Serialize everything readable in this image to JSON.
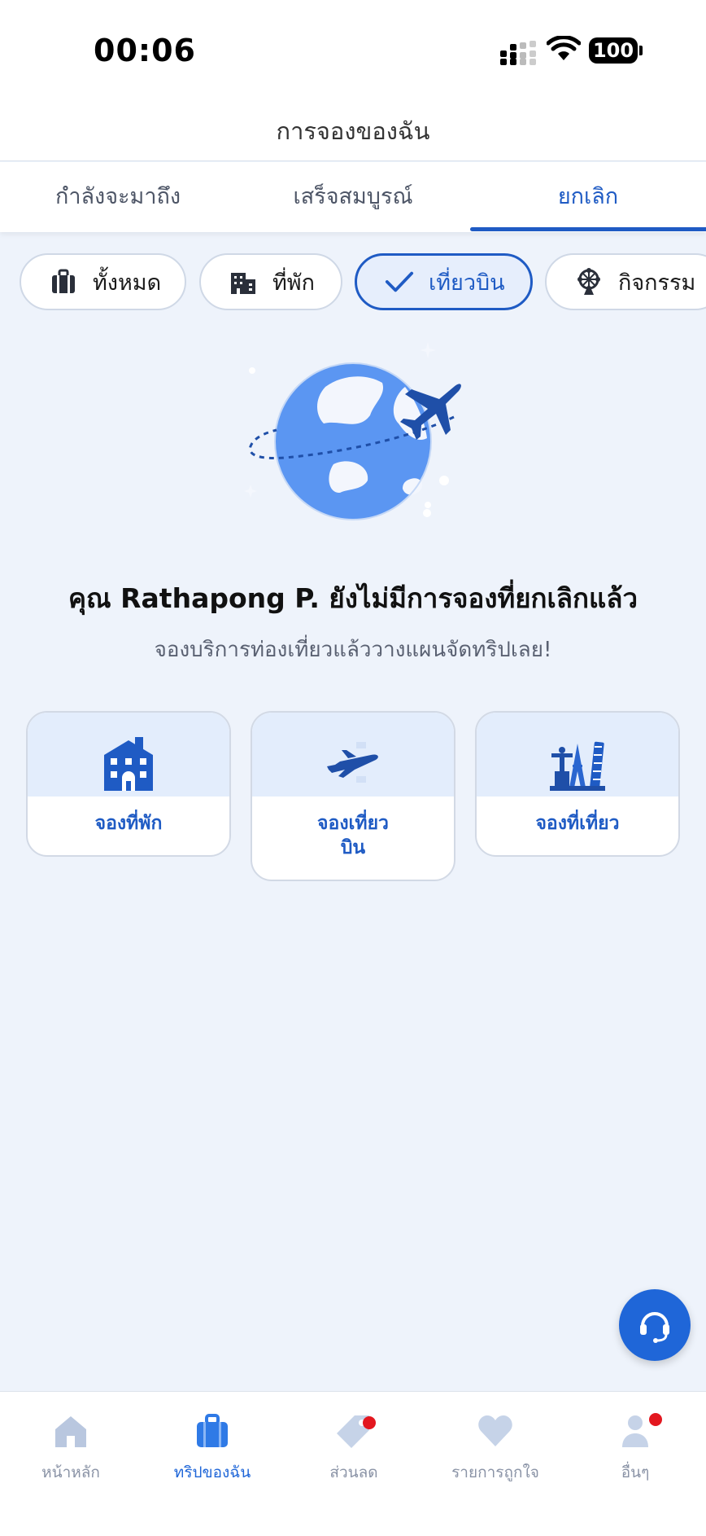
{
  "status": {
    "time": "00:06",
    "battery": "100"
  },
  "header": {
    "title": "การจองของฉัน"
  },
  "tabs": [
    {
      "label": "กำลังจะมาถึง"
    },
    {
      "label": "เสร็จสมบูรณ์"
    },
    {
      "label": "ยกเลิก",
      "active": true
    }
  ],
  "filters": [
    {
      "label": "ทั้งหมด",
      "icon": "suitcase-icon"
    },
    {
      "label": "ที่พัก",
      "icon": "building-icon"
    },
    {
      "label": "เที่ยวบิน",
      "icon": "check-icon",
      "active": true
    },
    {
      "label": "กิจกรรม",
      "icon": "ferris-wheel-icon"
    }
  ],
  "empty": {
    "title": "คุณ Rathapong P. ยังไม่มีการจองที่ยกเลิกแล้ว",
    "subtitle": "จองบริการท่องเที่ยวแล้ววางแผนจัดทริปเลย!"
  },
  "cards": [
    {
      "label": "จองที่พัก",
      "icon": "hotel-icon"
    },
    {
      "label_line1": "จองเที่ยว",
      "label_line2": "บิน",
      "icon": "airplane-icon"
    },
    {
      "label": "จองที่เที่ยว",
      "icon": "landmarks-icon"
    }
  ],
  "bottom_nav": [
    {
      "label": "หน้าหลัก",
      "icon": "home-icon"
    },
    {
      "label": "ทริปของฉัน",
      "icon": "suitcase-icon",
      "active": true
    },
    {
      "label": "ส่วนลด",
      "icon": "tag-icon",
      "badge": true
    },
    {
      "label": "รายการถูกใจ",
      "icon": "heart-icon"
    },
    {
      "label": "อื่นๆ",
      "icon": "profile-icon",
      "badge": true
    }
  ],
  "colors": {
    "accent": "#1f5bc4",
    "background": "#eef3fb",
    "badge": "#e3171f"
  }
}
